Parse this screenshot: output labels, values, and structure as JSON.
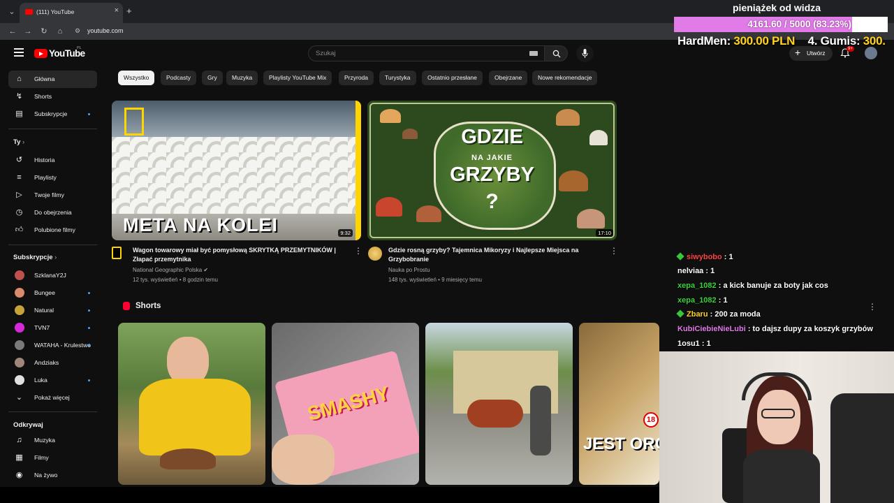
{
  "browser": {
    "tab_title": "(111) YouTube",
    "url": "youtube.com",
    "new_tab": "+",
    "close": "×"
  },
  "header": {
    "logo_text": "YouTube",
    "region": "PL",
    "search_placeholder": "Szukaj",
    "create_label": "Utwórz",
    "notifications": "9+"
  },
  "sidebar": {
    "main": [
      {
        "label": "Główna",
        "icon": "home-icon",
        "active": true
      },
      {
        "label": "Shorts",
        "icon": "shorts-icon"
      },
      {
        "label": "Subskrypcje",
        "icon": "subscriptions-icon",
        "dot": true
      }
    ],
    "you_heading": "Ty",
    "you": [
      {
        "label": "Historia",
        "icon": "history-icon"
      },
      {
        "label": "Playlisty",
        "icon": "playlists-icon"
      },
      {
        "label": "Twoje filmy",
        "icon": "your-videos-icon"
      },
      {
        "label": "Do obejrzenia",
        "icon": "watch-later-icon"
      },
      {
        "label": "Polubione filmy",
        "icon": "liked-icon"
      }
    ],
    "subs_heading": "Subskrypcje",
    "subs": [
      {
        "label": "SzklanaY2J",
        "color": "#c0504d",
        "dot": false
      },
      {
        "label": "Bungee",
        "color": "#d98c6c",
        "dot": true
      },
      {
        "label": "Natural",
        "color": "#c7a23a",
        "dot": true
      },
      {
        "label": "TVN7",
        "color": "#d62ad9",
        "dot": true
      },
      {
        "label": "WATAHA - Krulestwo",
        "color": "#7a7a7a",
        "dot": true
      },
      {
        "label": "Andziaks",
        "color": "#a0857a",
        "dot": false
      },
      {
        "label": "Luka",
        "color": "#e0e0e0",
        "dot": true
      },
      {
        "label": "Pokaż więcej",
        "color": "",
        "dot": false
      }
    ],
    "explore_heading": "Odkrywaj",
    "explore": [
      {
        "label": "Muzyka",
        "icon": "music-icon"
      },
      {
        "label": "Filmy",
        "icon": "movies-icon"
      },
      {
        "label": "Na żywo",
        "icon": "live-icon"
      }
    ]
  },
  "chips": [
    "Wszystko",
    "Podcasty",
    "Gry",
    "Muzyka",
    "Playlisty YouTube Mix",
    "Przyroda",
    "Turystyka",
    "Ostatnio przesłane",
    "Obejrzane",
    "Nowe rekomendacje"
  ],
  "videos": [
    {
      "title": "Wagon towarowy miał być pomysłową SKRYTKĄ PRZEMYTNIKÓW | Złapać przemytnika",
      "channel": "National Geographic Polska",
      "meta": "12 tys. wyświetleń • 8 godzin temu",
      "duration": "9:32",
      "thumb_text": "META NA KOLEI"
    },
    {
      "title": "Gdzie rosną grzyby? Tajemnica Mikoryzy i Najlepsze Miejsca na Grzybobranie",
      "channel": "Nauka po Prostu",
      "meta": "148 tys. wyświetleń • 9 miesięcy temu",
      "duration": "17:10",
      "thumb_top": "GDZIE",
      "thumb_mid": "NA JAKIE",
      "thumb_main": "GRZYBY",
      "thumb_q": "?"
    }
  ],
  "shorts": {
    "heading": "Shorts",
    "items": [
      {
        "label": ""
      },
      {
        "label": "SMASHY"
      },
      {
        "label": ""
      },
      {
        "label": "JEST ORG",
        "badge": "18"
      }
    ]
  },
  "overlay": {
    "donation_title": "pieniążek od widza",
    "donation_progress": "4161.60 / 5000 (83.23%)",
    "donation_fraction": 0.8323,
    "leader_name": "HardMen: ",
    "leader_amount": "300.00 PLN",
    "second_name": "4. Gumis: ",
    "second_amount": "300."
  },
  "chat": [
    {
      "user": "siwybobo",
      "text": " : 1",
      "color": "#ff4444",
      "badge": true
    },
    {
      "user": "nelviaa",
      "text": " : 1",
      "color": "#ffffff",
      "badge": false
    },
    {
      "user": "xepa_1082",
      "text": " : a kick banuje za boty jak cos",
      "color": "#3ad13a",
      "badge": false
    },
    {
      "user": "xepa_1082",
      "text": " : 1",
      "color": "#3ad13a",
      "badge": false
    },
    {
      "user": "Zbaru",
      "text": " : 200 za moda",
      "color": "#ffd21f",
      "badge": true
    },
    {
      "user": "KubiCiebieNieLubi",
      "text": " : to dajsz dupy za koszyk grzybów",
      "color": "#e07be7",
      "badge": false
    },
    {
      "user": "1osu1",
      "text": " : 1",
      "color": "#ffffff",
      "badge": false
    }
  ]
}
